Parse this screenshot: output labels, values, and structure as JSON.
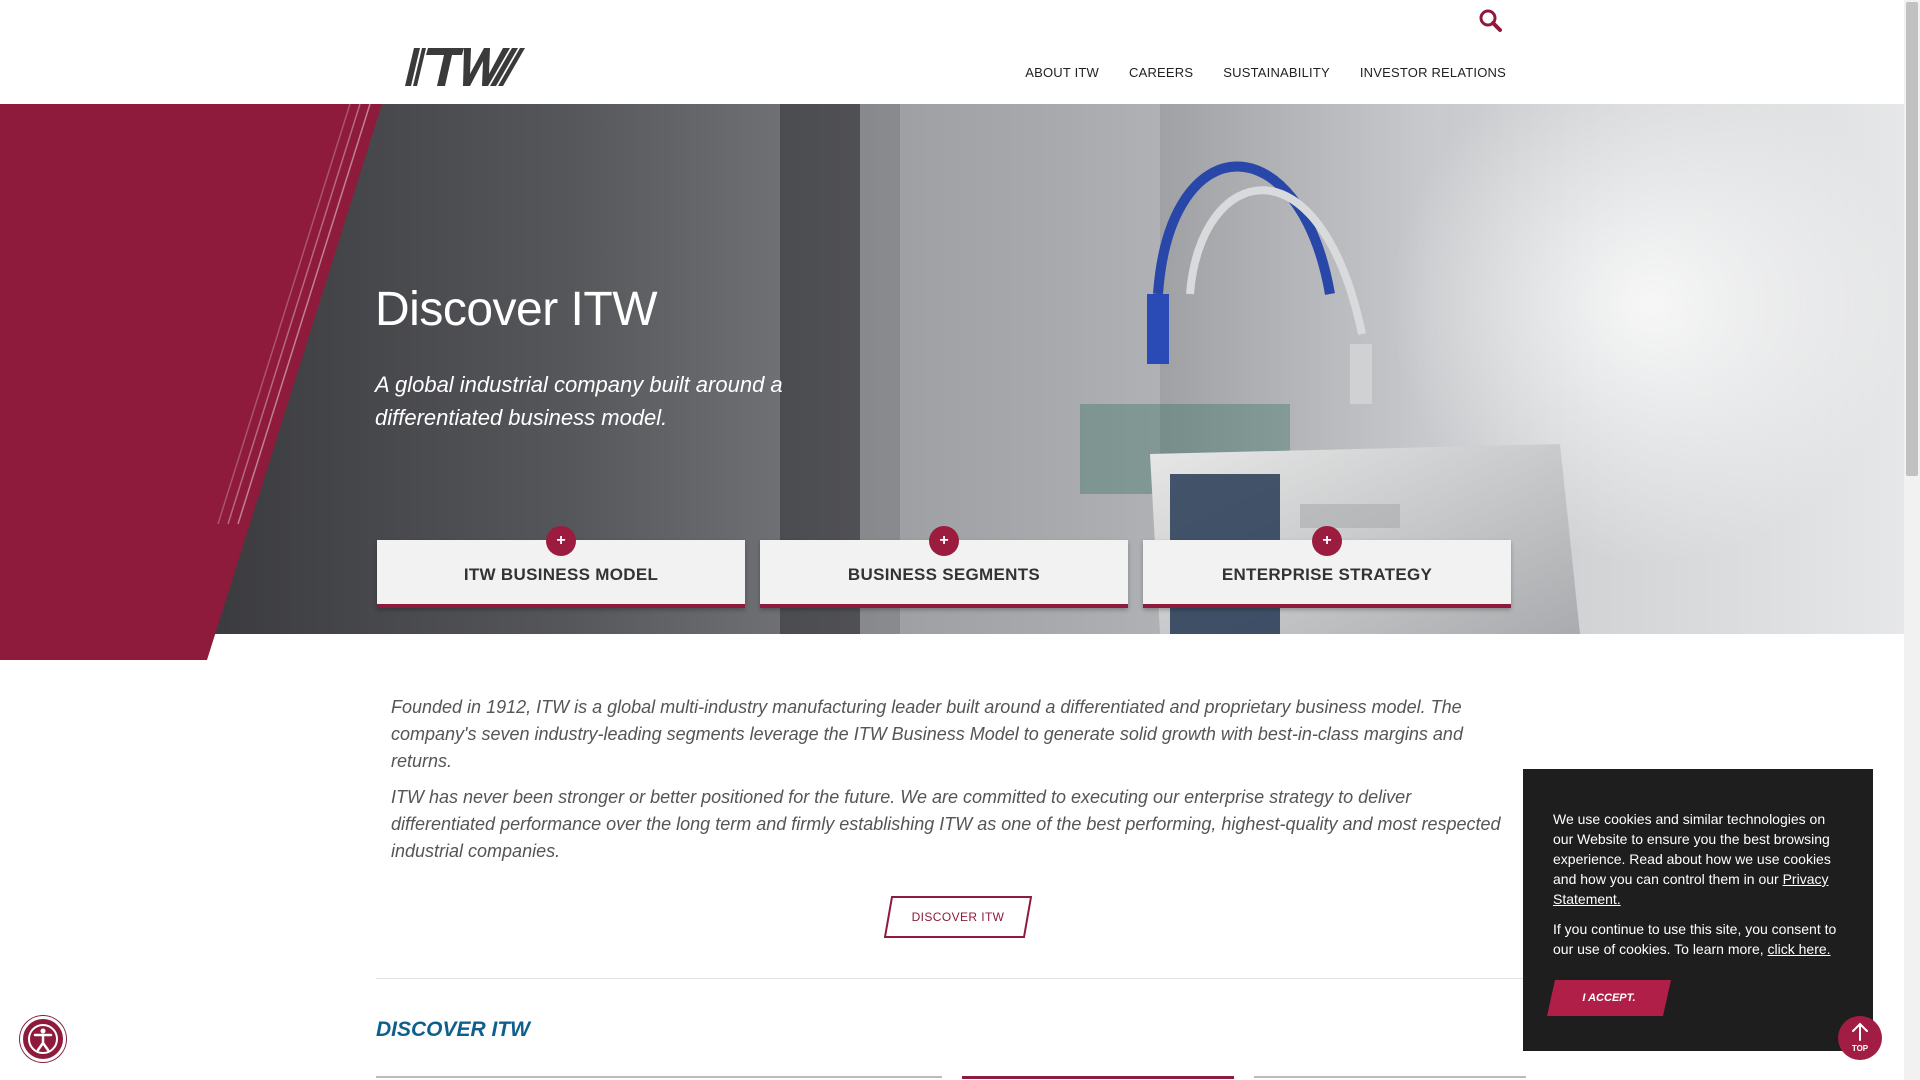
{
  "header": {
    "logo_text": "ITW",
    "nav": [
      "ABOUT ITW",
      "CAREERS",
      "SUSTAINABILITY",
      "INVESTOR RELATIONS"
    ],
    "search_icon": "search-icon"
  },
  "hero": {
    "title": "Discover ITW",
    "subtitle": "A global industrial company built around a differentiated business model.",
    "cards": [
      {
        "label": "ITW BUSINESS MODEL",
        "icon": "plus-icon"
      },
      {
        "label": "BUSINESS SEGMENTS",
        "icon": "plus-icon"
      },
      {
        "label": "ENTERPRISE STRATEGY",
        "icon": "plus-icon"
      }
    ],
    "card_plus": "+"
  },
  "intro": {
    "p1": "Founded in 1912, ITW is a global multi-industry manufacturing leader built around a differentiated and proprietary business model. The company's seven industry-leading segments leverage the ITW Business Model to generate solid growth with best-in-class margins and returns.",
    "p2": "ITW has never been stronger or better positioned for the future. We are committed to executing our enterprise strategy to deliver differentiated performance over the long term and firmly establishing ITW as one of the best performing, highest-quality and most respected industrial companies."
  },
  "discover_button": "DISCOVER ITW",
  "section_title": "DISCOVER ITW",
  "cookie": {
    "text1": "We use cookies and similar technologies on our Website to ensure you the best browsing experience. Read about how we use cookies and how you can control them in our ",
    "link1": "Privacy Statement.",
    "text2": "If you continue to use this site, you consent to our use of cookies. To learn more, ",
    "link2": "click here.",
    "accept": "I ACCEPT."
  },
  "top_button": "TOP",
  "colors": {
    "brand_maroon": "#8e1b3b",
    "section_blue": "#0e5f8e",
    "cookie_bg": "#1e1e1e"
  }
}
